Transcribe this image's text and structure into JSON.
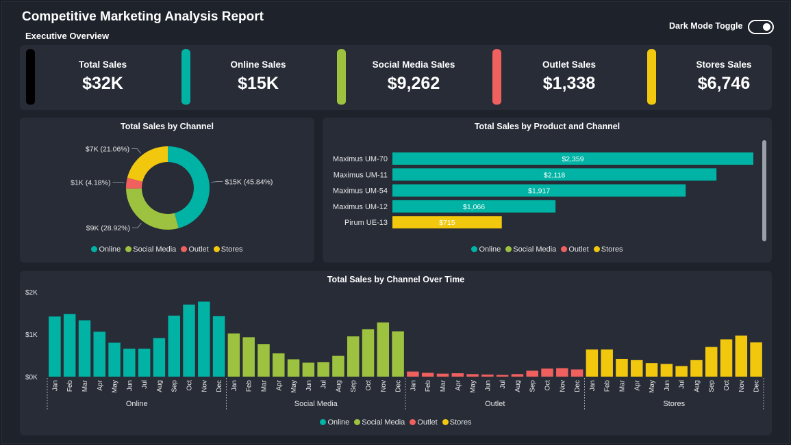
{
  "header": {
    "title": "Competitive Marketing Analysis Report",
    "subtitle": "Executive Overview",
    "toggle_label": "Dark Mode Toggle"
  },
  "colors": {
    "online": "#00b3a4",
    "social_media": "#9dc23f",
    "outlet": "#f0605e",
    "stores": "#f2c80f",
    "total": "#000000"
  },
  "kpis": [
    {
      "label": "Total Sales",
      "value": "$32K",
      "color": "#000000"
    },
    {
      "label": "Online Sales",
      "value": "$15K",
      "color": "#00b3a4"
    },
    {
      "label": "Social Media Sales",
      "value": "$9,262",
      "color": "#9dc23f"
    },
    {
      "label": "Outlet Sales",
      "value": "$1,338",
      "color": "#f0605e"
    },
    {
      "label": "Stores Sales",
      "value": "$6,746",
      "color": "#f2c80f"
    }
  ],
  "legend": [
    {
      "label": "Online",
      "color": "#00b3a4"
    },
    {
      "label": "Social Media",
      "color": "#9dc23f"
    },
    {
      "label": "Outlet",
      "color": "#f0605e"
    },
    {
      "label": "Stores",
      "color": "#f2c80f"
    }
  ],
  "chart_data": [
    {
      "type": "pie",
      "title": "Total Sales by Channel",
      "donut": true,
      "categories": [
        "Online",
        "Social Media",
        "Outlet",
        "Stores"
      ],
      "values": [
        45.84,
        28.92,
        4.18,
        21.06
      ],
      "labels": [
        "$15K (45.84%)",
        "$9K (28.92%)",
        "$1K (4.18%)",
        "$7K (21.06%)"
      ],
      "colors": [
        "#00b3a4",
        "#9dc23f",
        "#f0605e",
        "#f2c80f"
      ],
      "legend_position": "bottom"
    },
    {
      "type": "bar",
      "orientation": "horizontal",
      "title": "Total Sales by Product and Channel",
      "categories": [
        "Maximus UM-70",
        "Maximus UM-11",
        "Maximus UM-54",
        "Maximus UM-12",
        "Pirum UE-13"
      ],
      "values": [
        2359,
        2118,
        1917,
        1066,
        715
      ],
      "labels": [
        "$2,359",
        "$2,118",
        "$1,917",
        "$1,066",
        "$715"
      ],
      "series_by_bar": [
        "Online",
        "Online",
        "Online",
        "Online",
        "Stores"
      ],
      "legend_position": "bottom"
    },
    {
      "type": "bar",
      "title": "Total Sales by Channel Over Time",
      "ylim": [
        0,
        2000
      ],
      "yticks": [
        {
          "value": 0,
          "label": "$0K"
        },
        {
          "value": 1000,
          "label": "$1K"
        },
        {
          "value": 2000,
          "label": "$2K"
        }
      ],
      "months": [
        "Jan",
        "Feb",
        "Mar",
        "Apr",
        "May",
        "Jun",
        "Jul",
        "Aug",
        "Sep",
        "Oct",
        "Nov",
        "Dec"
      ],
      "groups": [
        {
          "name": "Online",
          "color": "#00b3a4",
          "values": [
            1420,
            1480,
            1330,
            1060,
            800,
            660,
            660,
            910,
            1440,
            1700,
            1770,
            1430
          ]
        },
        {
          "name": "Social Media",
          "color": "#9dc23f",
          "values": [
            1020,
            930,
            770,
            550,
            410,
            330,
            340,
            490,
            950,
            1120,
            1280,
            1070
          ]
        },
        {
          "name": "Outlet",
          "color": "#f0605e",
          "values": [
            120,
            90,
            70,
            80,
            60,
            50,
            40,
            60,
            140,
            190,
            200,
            170
          ]
        },
        {
          "name": "Stores",
          "color": "#f2c80f",
          "values": [
            640,
            640,
            420,
            390,
            320,
            300,
            250,
            390,
            700,
            880,
            970,
            810
          ]
        }
      ],
      "legend_position": "bottom"
    }
  ]
}
